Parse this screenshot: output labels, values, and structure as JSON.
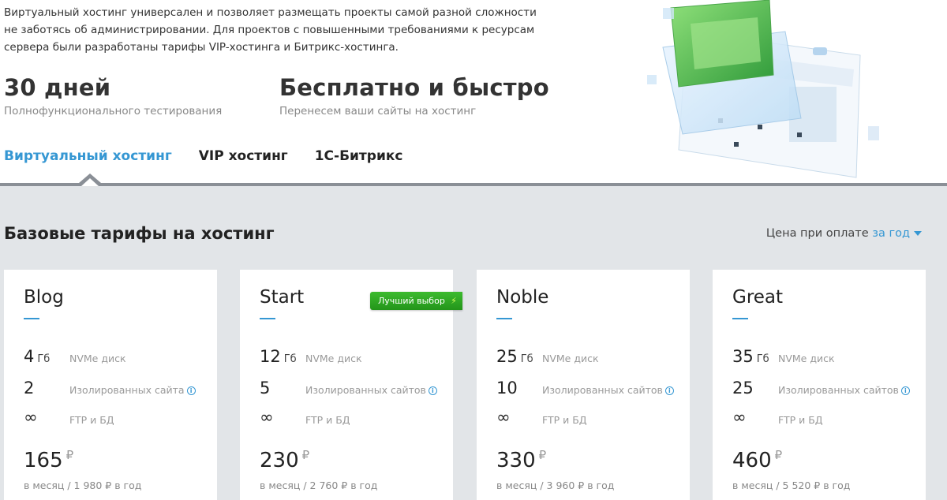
{
  "intro_text": "Виртуальный хостинг универсален и позволяет размещать проекты самой разной сложности не заботясь об администрировании. Для проектов с повышенными требованиями к ресурсам сервера были разработаны тарифы VIP-хостинга и Битрикс-хостинга.",
  "stats": [
    {
      "big": "30 дней",
      "small": "Полнофункционального тестирования"
    },
    {
      "big": "Бесплатно и быстро",
      "small": "Перенесем ваши сайты на хостинг"
    }
  ],
  "tabs": [
    {
      "label": "Виртуальный хостинг",
      "active": true
    },
    {
      "label": "VIP хостинг",
      "active": false
    },
    {
      "label": "1С-Битрикс",
      "active": false
    }
  ],
  "section_title": "Базовые тарифы на хостинг",
  "price_note": {
    "prefix": "Цена при оплате ",
    "period": "за год"
  },
  "badge": {
    "label": "Лучший выбор",
    "icon": "lightning-icon"
  },
  "row_labels": {
    "disk": "NVMe диск",
    "sites": "Изолированных сайтов",
    "sites_short": "Изолированных сайта",
    "ftp": "FTP и БД"
  },
  "disk_unit": "Гб",
  "infinity": "∞",
  "currency": "₽",
  "plans": [
    {
      "name": "Blog",
      "disk": "4",
      "sites": "2",
      "sites_label": "Изолированных сайта",
      "price": "165",
      "per_month": "в месяц / 1 980 ₽ в год"
    },
    {
      "name": "Start",
      "disk": "12",
      "sites": "5",
      "sites_label": "Изолированных сайтов",
      "price": "230",
      "per_month": "в месяц / 2 760 ₽ в год"
    },
    {
      "name": "Noble",
      "disk": "25",
      "sites": "10",
      "sites_label": "Изолированных сайтов",
      "price": "330",
      "per_month": "в месяц / 3 960 ₽ в год"
    },
    {
      "name": "Great",
      "disk": "35",
      "sites": "25",
      "sites_label": "Изолированных сайтов",
      "price": "460",
      "per_month": "в месяц / 5 520 ₽ в год"
    }
  ],
  "colors": {
    "accent": "#3597d3",
    "panel_bg": "#e2e5e8",
    "badge_green": "#2ea524"
  }
}
